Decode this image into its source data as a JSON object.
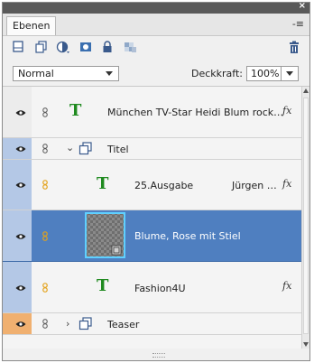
{
  "panel": {
    "tab_label": "Ebenen",
    "close_glyph": "×",
    "menu_glyph": "-≡"
  },
  "toolbar": {
    "icons": [
      "new-layer-icon",
      "new-group-icon",
      "adjustment-layer-icon",
      "layer-mask-icon",
      "lock-icon",
      "lock-transparency-icon",
      "trash-icon"
    ]
  },
  "options": {
    "blend_mode": "Normal",
    "opacity_label": "Deckkraft:",
    "opacity_value": "100%"
  },
  "colors": {
    "selected_row": "#4f7fc0",
    "group_row_gutter": "#b4c8e6",
    "teaser_gutter": "#f0b070",
    "link_orange": "#e3a21a",
    "text_layer_green": "#1f8a1f"
  },
  "layers": {
    "row0": {
      "name": "München TV-Star Heidi Blum rock…",
      "type": "text",
      "fx": "fx"
    },
    "row1": {
      "name": "Titel",
      "type": "group",
      "expanded": true
    },
    "row2": {
      "name": "25.Ausgabe",
      "extra": "Jürgen …",
      "type": "text",
      "fx": "fx"
    },
    "row3": {
      "name": "Blume, Rose mit Stiel",
      "type": "smart-object",
      "selected": true
    },
    "row4": {
      "name": "Fashion4U",
      "type": "text",
      "fx": "fx"
    },
    "row5": {
      "name": "Teaser",
      "type": "group",
      "expanded": false
    }
  }
}
